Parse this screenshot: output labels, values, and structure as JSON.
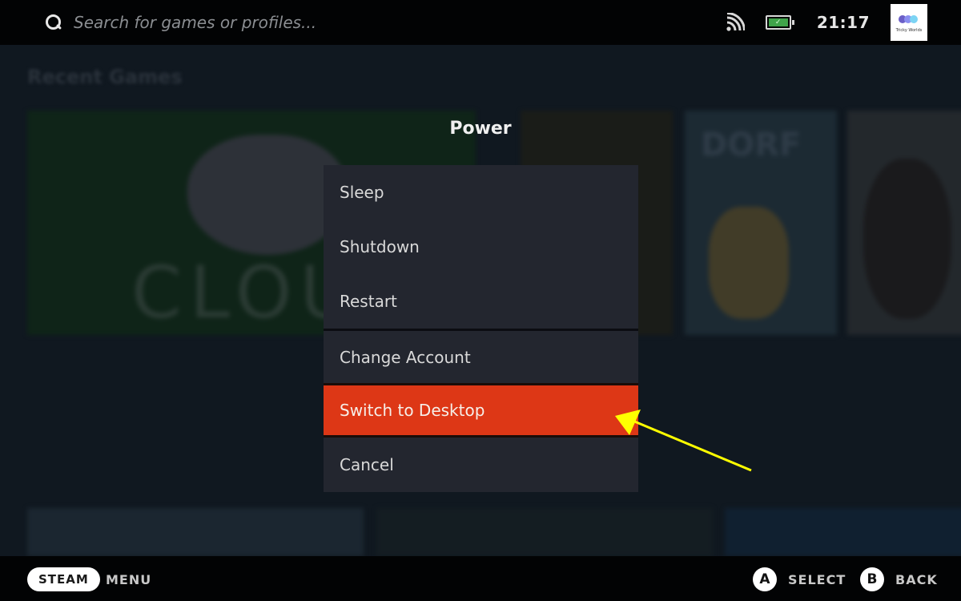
{
  "topbar": {
    "search_placeholder": "Search for games or profiles...",
    "icons": {
      "search": "search-icon",
      "network": "wifi-icon",
      "battery": "battery-charging-icon"
    },
    "battery_color": "#3fa34a",
    "clock": "21:17",
    "avatar_label": "Tricky Worlds"
  },
  "background": {
    "section_title": "Recent Games",
    "main_card_text": "CLOU",
    "card_b_text": "DORF"
  },
  "power_menu": {
    "title": "Power",
    "items": [
      {
        "label": "Sleep"
      },
      {
        "label": "Shutdown"
      },
      {
        "label": "Restart"
      },
      {
        "label": "Change Account"
      },
      {
        "label": "Switch to Desktop",
        "highlighted": true
      },
      {
        "label": "Cancel"
      }
    ],
    "highlight_color": "#dd3716"
  },
  "annotation": {
    "arrow_color": "#ffff00",
    "points_to": "Switch to Desktop"
  },
  "bottombar": {
    "steam_button": "STEAM",
    "menu_label": "MENU",
    "select_button": "A",
    "select_label": "SELECT",
    "back_button": "B",
    "back_label": "BACK"
  }
}
